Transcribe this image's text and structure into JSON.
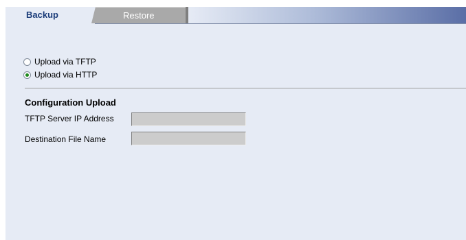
{
  "tabs": {
    "backup": "Backup",
    "restore": "Restore"
  },
  "options": {
    "tftp_label": "Upload via TFTP",
    "http_label": "Upload via HTTP",
    "selected": "http"
  },
  "section": {
    "title": "Configuration Upload",
    "ip_label": "TFTP Server IP Address",
    "ip_value": "",
    "file_label": "Destination File Name",
    "file_value": ""
  },
  "colors": {
    "page_background": "#e6ebf5",
    "active_tab_text": "#1c3d7a",
    "inactive_tab": "#a9a9a9",
    "field_background": "#cccccc",
    "radio_selected": "#1e8a1e"
  }
}
